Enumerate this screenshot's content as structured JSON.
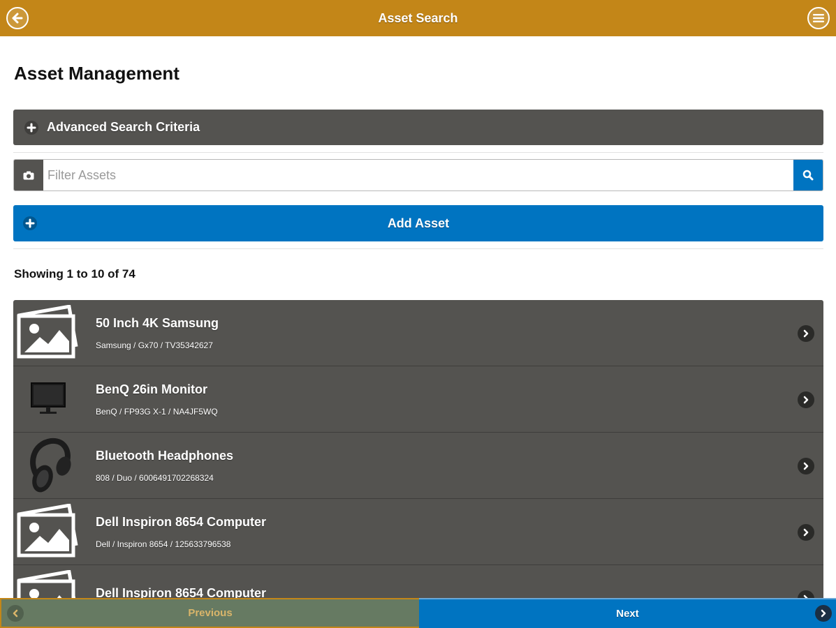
{
  "header": {
    "title": "Asset Search",
    "back_icon": "back-arrow-icon",
    "menu_icon": "hamburger-menu-icon",
    "bg_color": "#c38618"
  },
  "page": {
    "title": "Asset Management"
  },
  "advanced": {
    "label": "Advanced Search Criteria",
    "icon": "plus-icon"
  },
  "filter": {
    "placeholder": "Filter Assets",
    "value": "",
    "left_icon": "camera-icon",
    "right_icon": "search-icon"
  },
  "add": {
    "label": "Add Asset",
    "icon": "plus-icon",
    "color": "#0074c1"
  },
  "results": {
    "summary": "Showing 1 to 10 of 74"
  },
  "assets": [
    {
      "name": "50 Inch 4K Samsung",
      "details": "Samsung / Gx70 / TV35342627",
      "thumb": "placeholder-image-icon"
    },
    {
      "name": "BenQ 26in Monitor",
      "details": "BenQ / FP93G X-1 / NA4JF5WQ",
      "thumb": "monitor-photo"
    },
    {
      "name": "Bluetooth Headphones",
      "details": "808 / Duo / 6006491702268324",
      "thumb": "headphones-photo"
    },
    {
      "name": "Dell Inspiron 8654 Computer",
      "details": "Dell / Inspiron 8654 / 125633796538",
      "thumb": "placeholder-image-icon"
    },
    {
      "name": "Dell Inspiron 8654 Computer",
      "details": "",
      "thumb": "placeholder-image-icon"
    }
  ],
  "footer": {
    "prev_label": "Previous",
    "next_label": "Next"
  }
}
